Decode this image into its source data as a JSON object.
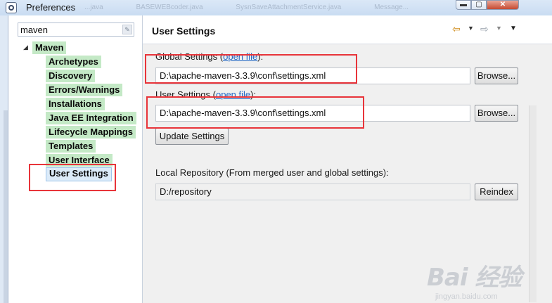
{
  "window": {
    "title": "Preferences",
    "background_tabs": [
      "...java",
      "BASEWEBcoder.java",
      "SysnSaveAttachmentService.java",
      "Message..."
    ],
    "controls": {
      "minimize": "▬",
      "maximize": "▢",
      "close": "✕"
    }
  },
  "sidebar": {
    "filter_value": "maven",
    "root": {
      "label": "Maven",
      "expanded": true
    },
    "items": [
      {
        "label": "Archetypes"
      },
      {
        "label": "Discovery"
      },
      {
        "label": "Errors/Warnings"
      },
      {
        "label": "Installations"
      },
      {
        "label": "Java EE Integration"
      },
      {
        "label": "Lifecycle Mappings"
      },
      {
        "label": "Templates"
      },
      {
        "label": "User Interface"
      },
      {
        "label": "User Settings",
        "selected": true
      }
    ],
    "highlight_color": "#c4e9c6"
  },
  "page": {
    "title": "User Settings",
    "global_settings": {
      "label": "Global Settings (",
      "link": "open file",
      "suffix": "):",
      "value": "D:\\apache-maven-3.3.9\\conf\\settings.xml",
      "browse_label": "Browse..."
    },
    "user_settings": {
      "label": "User Settings (",
      "link": "open file",
      "suffix": "):",
      "value": "D:\\apache-maven-3.3.9\\conf\\settings.xml",
      "browse_label": "Browse..."
    },
    "update_label": "Update Settings",
    "local_repo": {
      "label": "Local Repository (From merged user and global settings):",
      "value": "D:/repository",
      "reindex_label": "Reindex"
    }
  },
  "watermark": {
    "text": "Bai 经验",
    "url": "jingyan.baidu.com"
  },
  "annotation_color": "#e8343a"
}
